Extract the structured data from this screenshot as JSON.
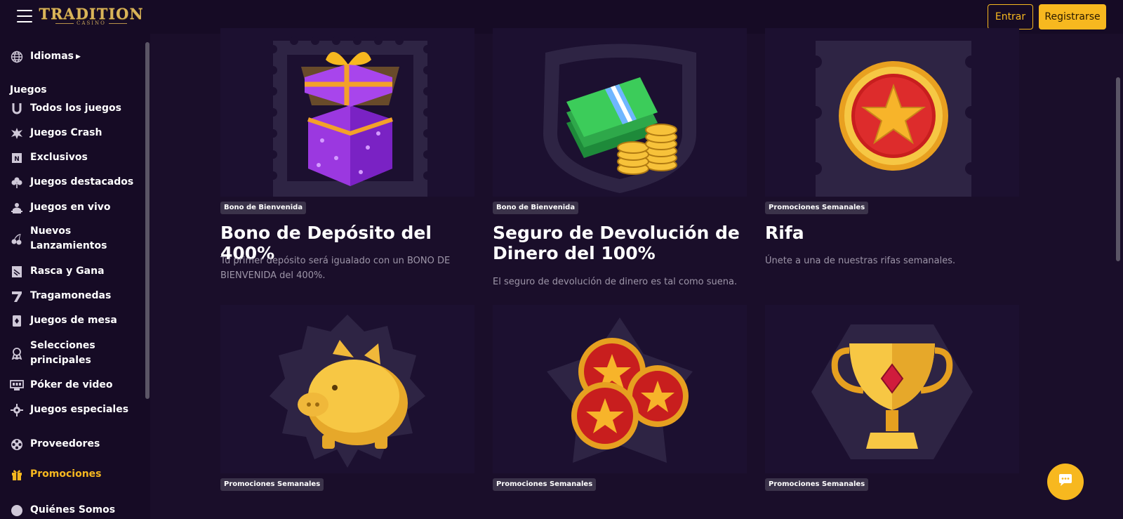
{
  "header": {
    "logo_main": "TRADITION",
    "logo_sub": "CASINO",
    "login_label": "Entrar",
    "register_label": "Registrarse"
  },
  "sidebar": {
    "languages": "Idiomas",
    "games_heading": "Juegos",
    "items": [
      {
        "label": "Todos los juegos",
        "icon": "horseshoe-icon"
      },
      {
        "label": "Juegos Crash",
        "icon": "explosion-icon"
      },
      {
        "label": "Exclusivos",
        "icon": "exclusive-icon"
      },
      {
        "label": "Juegos destacados",
        "icon": "clover-icon"
      },
      {
        "label": "Juegos en vivo",
        "icon": "live-dealer-icon"
      },
      {
        "label": "Nuevos Lanzamientos",
        "icon": "cherries-icon"
      },
      {
        "label": "Rasca y Gana",
        "icon": "scratch-card-icon"
      },
      {
        "label": "Tragamonedas",
        "icon": "seven-icon"
      },
      {
        "label": "Juegos de mesa",
        "icon": "playing-card-icon"
      },
      {
        "label": "Selecciones principales",
        "icon": "award-ribbon-icon"
      },
      {
        "label": "Póker de video",
        "icon": "video-poker-icon"
      },
      {
        "label": "Juegos especiales",
        "icon": "special-gear-icon"
      }
    ],
    "providers": "Proveedores",
    "promotions": "Promociones",
    "about_partial": "Quiénes Somos"
  },
  "cards": [
    {
      "badge": "Bono de Bienvenida",
      "title": "Bono de Depósito del 400%",
      "description": "Tu primer depósito será igualado con un BONO DE BIENVENIDA del 400%.",
      "image": "gift-box"
    },
    {
      "badge": "Bono de Bienvenida",
      "title": "Seguro de Devolución de Dinero del 100%",
      "description": "El seguro de devolución de dinero es tal como suena.",
      "image": "cash-and-coins"
    },
    {
      "badge": "Promociones Semanales",
      "title": "Rifa",
      "description": "Únete a una de nuestras rifas semanales.",
      "image": "star-medal"
    },
    {
      "badge": "Promociones Semanales",
      "title": "",
      "description": "",
      "image": "piggy-bank"
    },
    {
      "badge": "Promociones Semanales",
      "title": "",
      "description": "",
      "image": "star-coins"
    },
    {
      "badge": "Promociones Semanales",
      "title": "",
      "description": "",
      "image": "trophy"
    }
  ],
  "colors": {
    "accent": "#f7b81f",
    "background": "#1a0e2a",
    "sidebar": "#160b25",
    "badge": "#3b334a",
    "muted_text": "#9d95a8"
  }
}
